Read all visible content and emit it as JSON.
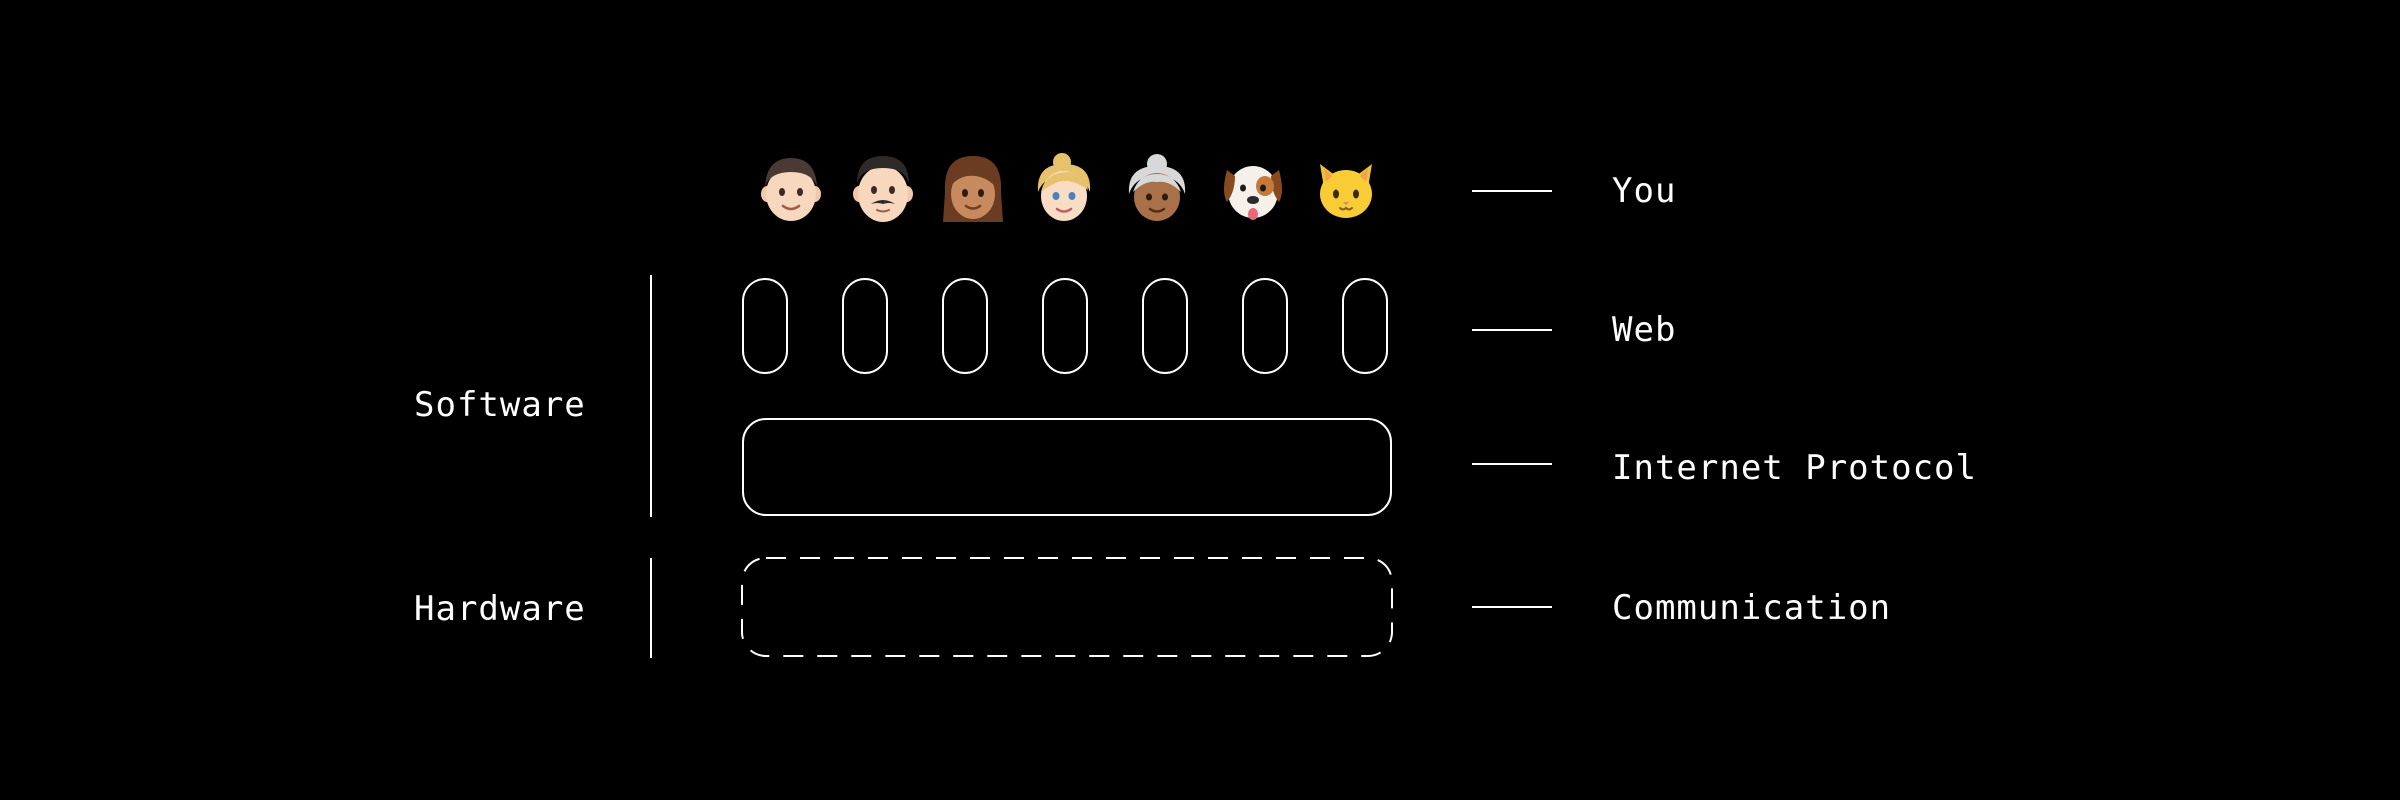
{
  "layers": [
    {
      "label": "You"
    },
    {
      "label": "Web"
    },
    {
      "label": "Internet Protocol"
    },
    {
      "label": "Communication"
    }
  ],
  "groups": [
    {
      "label": "Software"
    },
    {
      "label": "Hardware"
    }
  ],
  "users": [
    {
      "icon": "boy-face-icon"
    },
    {
      "icon": "man-mustache-face-icon"
    },
    {
      "icon": "woman-face-icon"
    },
    {
      "icon": "blonde-girl-face-icon"
    },
    {
      "icon": "grandmother-face-icon"
    },
    {
      "icon": "dog-face-icon"
    },
    {
      "icon": "cat-face-icon"
    }
  ],
  "colors": {
    "background": "#000000",
    "foreground": "#ffffff"
  }
}
